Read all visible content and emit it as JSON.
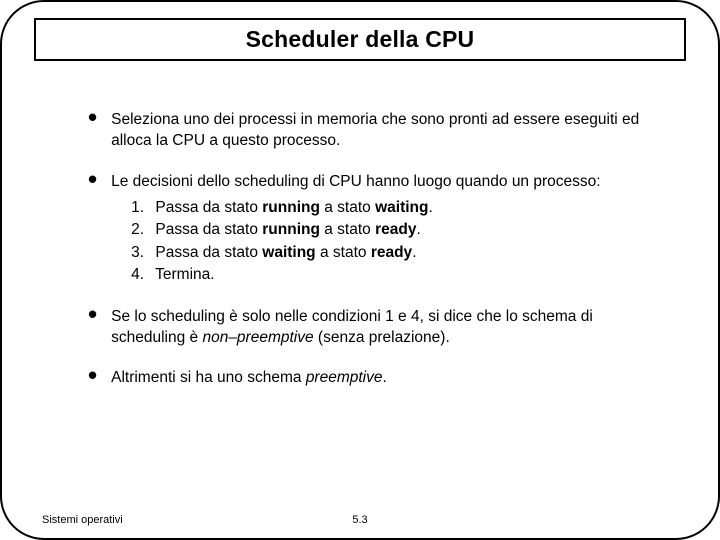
{
  "title": "Scheduler della CPU",
  "bullet1": "Seleziona uno dei processi in memoria che sono pronti ad essere eseguiti ed alloca la CPU a questo processo.",
  "bullet2_intro": "Le decisioni dello scheduling di CPU hanno luogo quando un processo:",
  "sub": {
    "n1": "1.",
    "n2": "2.",
    "n3": "3.",
    "n4": "4.",
    "s1_pre": "Passa da stato ",
    "s1_b1": "running",
    "s1_mid": " a stato ",
    "s1_b2": "waiting",
    "s1_post": ".",
    "s2_pre": "Passa da stato ",
    "s2_b1": "running",
    "s2_mid": " a stato ",
    "s2_b2": "ready",
    "s2_post": ".",
    "s3_pre": "Passa da stato ",
    "s3_b1": "waiting",
    "s3_mid": " a stato ",
    "s3_b2": "ready",
    "s3_post": ".",
    "s4": "Termina."
  },
  "bullet3_pre": "Se lo scheduling è solo nelle condizioni 1 e 4, si dice che lo schema di scheduling è ",
  "bullet3_it": "non–preemptive",
  "bullet3_post": " (senza prelazione).",
  "bullet4_pre": "Altrimenti si ha uno schema ",
  "bullet4_it": "preemptive",
  "bullet4_post": ".",
  "footer_left": "Sistemi operativi",
  "footer_center": "5.3"
}
